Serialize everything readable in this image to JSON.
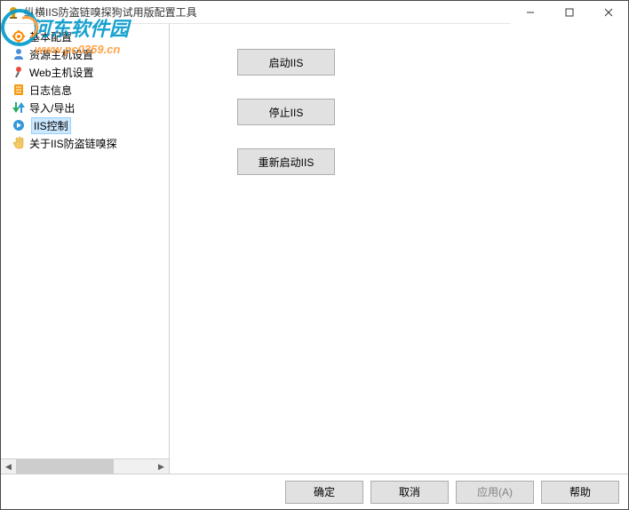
{
  "window": {
    "title": "纵横IIS防盗链嗅探狗试用版配置工具"
  },
  "watermark": {
    "brand": "河东软件园",
    "url": "www.pc0359.cn"
  },
  "sidebar": {
    "items": [
      {
        "label": "基本配置",
        "icon": "gear"
      },
      {
        "label": "资源主机设置",
        "icon": "user"
      },
      {
        "label": "Web主机设置",
        "icon": "pin"
      },
      {
        "label": "日志信息",
        "icon": "book"
      },
      {
        "label": "导入/导出",
        "icon": "arrow"
      },
      {
        "label": "IIS控制",
        "icon": "play",
        "selected": true
      },
      {
        "label": "关于IIS防盗链嗅探",
        "icon": "hand"
      }
    ]
  },
  "main": {
    "buttons": [
      "启动IIS",
      "停止IIS",
      "重新启动IIS"
    ]
  },
  "footer": {
    "ok": "确定",
    "cancel": "取消",
    "apply": "应用(A)",
    "help": "帮助"
  }
}
